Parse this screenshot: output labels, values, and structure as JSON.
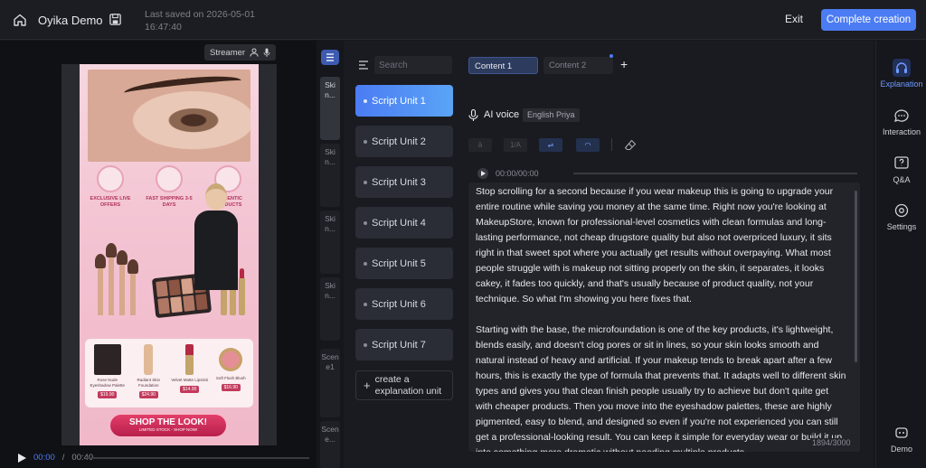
{
  "header": {
    "title": "Oyika Demo",
    "last_saved": "Last saved on 2026-05-01 16:47:40",
    "exit_label": "Exit",
    "complete_label": "Complete creation"
  },
  "preview": {
    "streamer_label": "Streamer",
    "features": [
      "EXCLUSIVE LIVE OFFERS",
      "FAST SHIPPING 3-5 DAYS",
      "AUTHENTIC PRODUCTS"
    ],
    "products": [
      {
        "name": "Rose Nude Eyeshadow Palette",
        "price": "$19.90"
      },
      {
        "name": "Radiant Skin Foundation",
        "price": "$24.90"
      },
      {
        "name": "Velvet Matte Lipstick",
        "price": "$14.90"
      },
      {
        "name": "Soft Flush Blush",
        "price": "$16.90"
      }
    ],
    "cta_main": "SHOP THE LOOK!",
    "cta_sub": "LIMITED STOCK - SHOP NOW!",
    "time_current": "00:00",
    "time_separator": "/",
    "time_total": "00:40"
  },
  "scenes": {
    "tabs": [
      "Skin...",
      "Skin...",
      "Skin...",
      "Skin...",
      "Scene1",
      "Scene..."
    ]
  },
  "script_list": {
    "search_placeholder": "Search",
    "units": [
      "Script Unit 1",
      "Script Unit 2",
      "Script Unit 3",
      "Script Unit 4",
      "Script Unit 5",
      "Script Unit 6",
      "Script Unit 7"
    ],
    "create_label": "create a explanation unit"
  },
  "editor": {
    "content_tabs": [
      "Content 1",
      "Content 2"
    ],
    "voice_label": "AI voice",
    "voice_name": "English Priya",
    "audio_time": "00:00/00:00",
    "script_text": "Stop scrolling for a second because if you wear makeup this is going to upgrade your entire routine while saving you money at the same time. Right now you're looking at MakeupStore, known for professional-level cosmetics with clean formulas and long-lasting performance, not cheap drugstore quality but also not overpriced luxury, it sits right in that sweet spot where you actually get results without overpaying. What most people struggle with is makeup not sitting properly on the skin, it separates, it looks cakey, it fades too quickly, and that's usually because of product quality, not your technique. So what I'm showing you here fixes that.\n\nStarting with the base, the microfoundation is one of the key products, it's lightweight, blends easily, and doesn't clog pores or sit in lines, so your skin looks smooth and natural instead of heavy and artificial. If your makeup tends to break apart after a few hours, this is exactly the type of formula that prevents that. It adapts well to different skin types and gives you that clean finish people usually try to achieve but don't quite get with cheaper products. Then you move into the eyeshadow palettes, these are highly pigmented, easy to blend, and designed so even if you're not experienced you can still get a professional-looking result. You can keep it simple for everyday wear or build it up into something more dramatic without needing multiple products.",
    "char_count": "1894/3000"
  },
  "rail": {
    "items": [
      "Explanation",
      "Interaction",
      "Q&A",
      "Settings"
    ],
    "demo_label": "Demo"
  },
  "colors": {
    "accent": "#4b7cf3",
    "background": "#16171c",
    "panel": "#1a1b21"
  }
}
